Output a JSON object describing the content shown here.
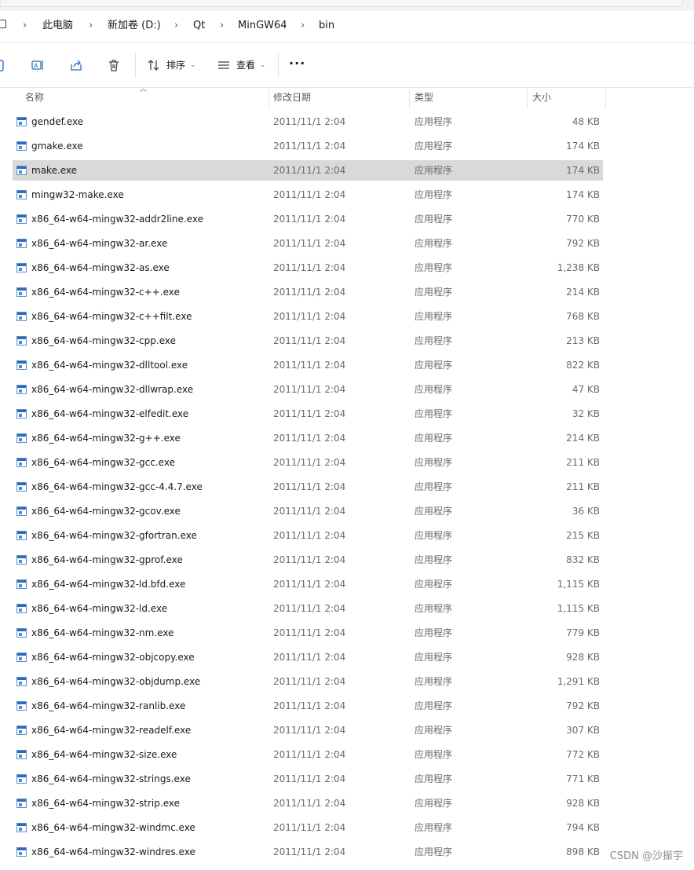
{
  "breadcrumb": [
    "此电脑",
    "新加卷 (D:)",
    "Qt",
    "MinGW64",
    "bin"
  ],
  "toolbar": {
    "sort_label": "排序",
    "view_label": "查看",
    "more_label": "···"
  },
  "columns": {
    "name": "名称",
    "date": "修改日期",
    "type": "类型",
    "size": "大小"
  },
  "selected_index": 2,
  "files": [
    {
      "name": "gendef.exe",
      "date": "2011/11/1 2:04",
      "type": "应用程序",
      "size": "48 KB"
    },
    {
      "name": "gmake.exe",
      "date": "2011/11/1 2:04",
      "type": "应用程序",
      "size": "174 KB"
    },
    {
      "name": "make.exe",
      "date": "2011/11/1 2:04",
      "type": "应用程序",
      "size": "174 KB"
    },
    {
      "name": "mingw32-make.exe",
      "date": "2011/11/1 2:04",
      "type": "应用程序",
      "size": "174 KB"
    },
    {
      "name": "x86_64-w64-mingw32-addr2line.exe",
      "date": "2011/11/1 2:04",
      "type": "应用程序",
      "size": "770 KB"
    },
    {
      "name": "x86_64-w64-mingw32-ar.exe",
      "date": "2011/11/1 2:04",
      "type": "应用程序",
      "size": "792 KB"
    },
    {
      "name": "x86_64-w64-mingw32-as.exe",
      "date": "2011/11/1 2:04",
      "type": "应用程序",
      "size": "1,238 KB"
    },
    {
      "name": "x86_64-w64-mingw32-c++.exe",
      "date": "2011/11/1 2:04",
      "type": "应用程序",
      "size": "214 KB"
    },
    {
      "name": "x86_64-w64-mingw32-c++filt.exe",
      "date": "2011/11/1 2:04",
      "type": "应用程序",
      "size": "768 KB"
    },
    {
      "name": "x86_64-w64-mingw32-cpp.exe",
      "date": "2011/11/1 2:04",
      "type": "应用程序",
      "size": "213 KB"
    },
    {
      "name": "x86_64-w64-mingw32-dlltool.exe",
      "date": "2011/11/1 2:04",
      "type": "应用程序",
      "size": "822 KB"
    },
    {
      "name": "x86_64-w64-mingw32-dllwrap.exe",
      "date": "2011/11/1 2:04",
      "type": "应用程序",
      "size": "47 KB"
    },
    {
      "name": "x86_64-w64-mingw32-elfedit.exe",
      "date": "2011/11/1 2:04",
      "type": "应用程序",
      "size": "32 KB"
    },
    {
      "name": "x86_64-w64-mingw32-g++.exe",
      "date": "2011/11/1 2:04",
      "type": "应用程序",
      "size": "214 KB"
    },
    {
      "name": "x86_64-w64-mingw32-gcc.exe",
      "date": "2011/11/1 2:04",
      "type": "应用程序",
      "size": "211 KB"
    },
    {
      "name": "x86_64-w64-mingw32-gcc-4.4.7.exe",
      "date": "2011/11/1 2:04",
      "type": "应用程序",
      "size": "211 KB"
    },
    {
      "name": "x86_64-w64-mingw32-gcov.exe",
      "date": "2011/11/1 2:04",
      "type": "应用程序",
      "size": "36 KB"
    },
    {
      "name": "x86_64-w64-mingw32-gfortran.exe",
      "date": "2011/11/1 2:04",
      "type": "应用程序",
      "size": "215 KB"
    },
    {
      "name": "x86_64-w64-mingw32-gprof.exe",
      "date": "2011/11/1 2:04",
      "type": "应用程序",
      "size": "832 KB"
    },
    {
      "name": "x86_64-w64-mingw32-ld.bfd.exe",
      "date": "2011/11/1 2:04",
      "type": "应用程序",
      "size": "1,115 KB"
    },
    {
      "name": "x86_64-w64-mingw32-ld.exe",
      "date": "2011/11/1 2:04",
      "type": "应用程序",
      "size": "1,115 KB"
    },
    {
      "name": "x86_64-w64-mingw32-nm.exe",
      "date": "2011/11/1 2:04",
      "type": "应用程序",
      "size": "779 KB"
    },
    {
      "name": "x86_64-w64-mingw32-objcopy.exe",
      "date": "2011/11/1 2:04",
      "type": "应用程序",
      "size": "928 KB"
    },
    {
      "name": "x86_64-w64-mingw32-objdump.exe",
      "date": "2011/11/1 2:04",
      "type": "应用程序",
      "size": "1,291 KB"
    },
    {
      "name": "x86_64-w64-mingw32-ranlib.exe",
      "date": "2011/11/1 2:04",
      "type": "应用程序",
      "size": "792 KB"
    },
    {
      "name": "x86_64-w64-mingw32-readelf.exe",
      "date": "2011/11/1 2:04",
      "type": "应用程序",
      "size": "307 KB"
    },
    {
      "name": "x86_64-w64-mingw32-size.exe",
      "date": "2011/11/1 2:04",
      "type": "应用程序",
      "size": "772 KB"
    },
    {
      "name": "x86_64-w64-mingw32-strings.exe",
      "date": "2011/11/1 2:04",
      "type": "应用程序",
      "size": "771 KB"
    },
    {
      "name": "x86_64-w64-mingw32-strip.exe",
      "date": "2011/11/1 2:04",
      "type": "应用程序",
      "size": "928 KB"
    },
    {
      "name": "x86_64-w64-mingw32-windmc.exe",
      "date": "2011/11/1 2:04",
      "type": "应用程序",
      "size": "794 KB"
    },
    {
      "name": "x86_64-w64-mingw32-windres.exe",
      "date": "2011/11/1 2:04",
      "type": "应用程序",
      "size": "898 KB"
    }
  ],
  "watermark": "CSDN @沙振宇"
}
